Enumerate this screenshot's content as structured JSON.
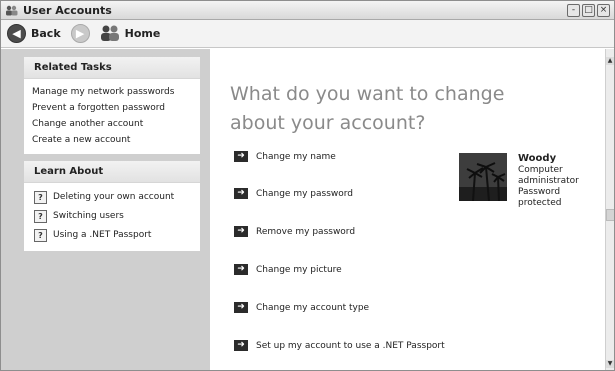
{
  "window": {
    "title": "User Accounts",
    "controls": [
      "-",
      "□",
      "×"
    ]
  },
  "toolbar": {
    "back_label": "Back",
    "home_label": "Home"
  },
  "related_tasks": {
    "header": "Related Tasks",
    "items": [
      "Manage my network passwords",
      "Prevent a forgotten password",
      "Change another account",
      "Create a new account"
    ]
  },
  "learn_about": {
    "header": "Learn About",
    "items": [
      "Deleting your own account",
      "Switching users",
      "Using a .NET Passport"
    ]
  },
  "main": {
    "heading": "What do you want to change about your account?",
    "actions": [
      "Change my name",
      "Change my password",
      "Remove my password",
      "Change my picture",
      "Change my account type",
      "Set up my account to use a .NET Passport"
    ]
  },
  "user": {
    "name": "Woody",
    "type_line1": "Computer",
    "type_line2": "administrator",
    "status_line1": "Password",
    "status_line2": "protected"
  },
  "icons": {
    "app": "users-icon",
    "back": "back-arrow-icon",
    "forward": "forward-arrow-icon",
    "home": "home-users-icon",
    "help": "help-icon",
    "action": "arrow-right-icon"
  }
}
